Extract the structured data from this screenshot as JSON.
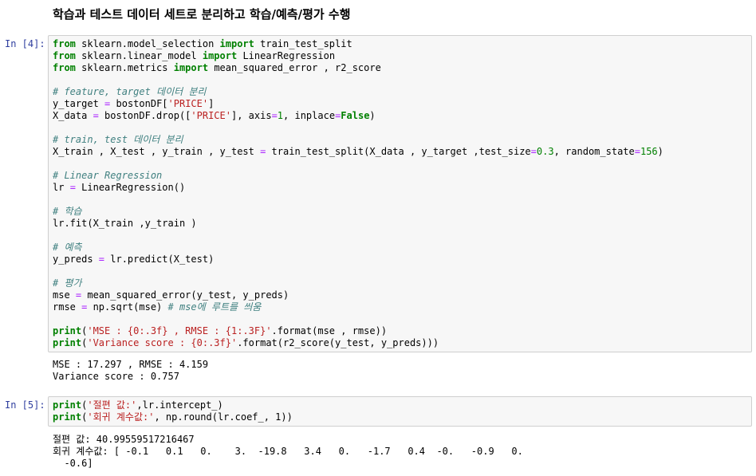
{
  "heading": "학습과 테스트 데이터 세트로 분리하고 학습/예측/평가 수행",
  "cell4": {
    "prompt": "In [4]:",
    "lines": [
      [
        [
          "kw",
          "from"
        ],
        [
          "t",
          " sklearn.model_selection "
        ],
        [
          "kw",
          "import"
        ],
        [
          "t",
          " train_test_split"
        ]
      ],
      [
        [
          "kw",
          "from"
        ],
        [
          "t",
          " sklearn.linear_model "
        ],
        [
          "kw",
          "import"
        ],
        [
          "t",
          " LinearRegression"
        ]
      ],
      [
        [
          "kw",
          "from"
        ],
        [
          "t",
          " sklearn.metrics "
        ],
        [
          "kw",
          "import"
        ],
        [
          "t",
          " mean_squared_error , r2_score"
        ]
      ],
      [],
      [
        [
          "cm",
          "# feature, target 데이터 분리"
        ]
      ],
      [
        [
          "t",
          "y_target "
        ],
        [
          "op",
          "="
        ],
        [
          "t",
          " bostonDF["
        ],
        [
          "st",
          "'PRICE'"
        ],
        [
          "t",
          "]"
        ]
      ],
      [
        [
          "t",
          "X_data "
        ],
        [
          "op",
          "="
        ],
        [
          "t",
          " bostonDF.drop(["
        ],
        [
          "st",
          "'PRICE'"
        ],
        [
          "t",
          "], axis"
        ],
        [
          "op",
          "="
        ],
        [
          "nm",
          "1"
        ],
        [
          "t",
          ", inplace"
        ],
        [
          "op",
          "="
        ],
        [
          "bl",
          "False"
        ],
        [
          "t",
          ")"
        ]
      ],
      [],
      [
        [
          "cm",
          "# train, test 데이터 분리"
        ]
      ],
      [
        [
          "t",
          "X_train , X_test , y_train , y_test "
        ],
        [
          "op",
          "="
        ],
        [
          "t",
          " train_test_split(X_data , y_target ,test_size"
        ],
        [
          "op",
          "="
        ],
        [
          "nm",
          "0.3"
        ],
        [
          "t",
          ", random_state"
        ],
        [
          "op",
          "="
        ],
        [
          "nm",
          "156"
        ],
        [
          "t",
          ")"
        ]
      ],
      [],
      [
        [
          "cm",
          "# Linear Regression"
        ]
      ],
      [
        [
          "t",
          "lr "
        ],
        [
          "op",
          "="
        ],
        [
          "t",
          " LinearRegression()"
        ]
      ],
      [],
      [
        [
          "cm",
          "# 학습"
        ]
      ],
      [
        [
          "t",
          "lr.fit(X_train ,y_train )"
        ]
      ],
      [],
      [
        [
          "cm",
          "# 예측"
        ]
      ],
      [
        [
          "t",
          "y_preds "
        ],
        [
          "op",
          "="
        ],
        [
          "t",
          " lr.predict(X_test)"
        ]
      ],
      [],
      [
        [
          "cm",
          "# 평가"
        ]
      ],
      [
        [
          "t",
          "mse "
        ],
        [
          "op",
          "="
        ],
        [
          "t",
          " mean_squared_error(y_test, y_preds)"
        ]
      ],
      [
        [
          "t",
          "rmse "
        ],
        [
          "op",
          "="
        ],
        [
          "t",
          " np.sqrt(mse) "
        ],
        [
          "cm",
          "# mse에 루트를 씌움"
        ]
      ],
      [],
      [
        [
          "kw",
          "print"
        ],
        [
          "t",
          "("
        ],
        [
          "st",
          "'MSE : {0:.3f} , RMSE : {1:.3F}'"
        ],
        [
          "t",
          ".format(mse , rmse))"
        ]
      ],
      [
        [
          "kw",
          "print"
        ],
        [
          "t",
          "("
        ],
        [
          "st",
          "'Variance score : {0:.3f}'"
        ],
        [
          "t",
          ".format(r2_score(y_test, y_preds)))"
        ]
      ]
    ],
    "output": [
      "MSE : 17.297 , RMSE : 4.159",
      "Variance score : 0.757"
    ]
  },
  "cell5": {
    "prompt": "In [5]:",
    "lines": [
      [
        [
          "kw",
          "print"
        ],
        [
          "t",
          "("
        ],
        [
          "st",
          "'절편 값:'"
        ],
        [
          "t",
          ",lr.intercept_)"
        ]
      ],
      [
        [
          "kw",
          "print"
        ],
        [
          "t",
          "("
        ],
        [
          "st",
          "'회귀 계수값:'"
        ],
        [
          "t",
          ", np.round(lr.coef_, 1))"
        ]
      ]
    ],
    "output": [
      "절편 값: 40.99559517216467",
      "회귀 계수값: [ -0.1   0.1   0.    3.  -19.8   3.4   0.   -1.7   0.4  -0.   -0.9   0.",
      "  -0.6]"
    ]
  }
}
